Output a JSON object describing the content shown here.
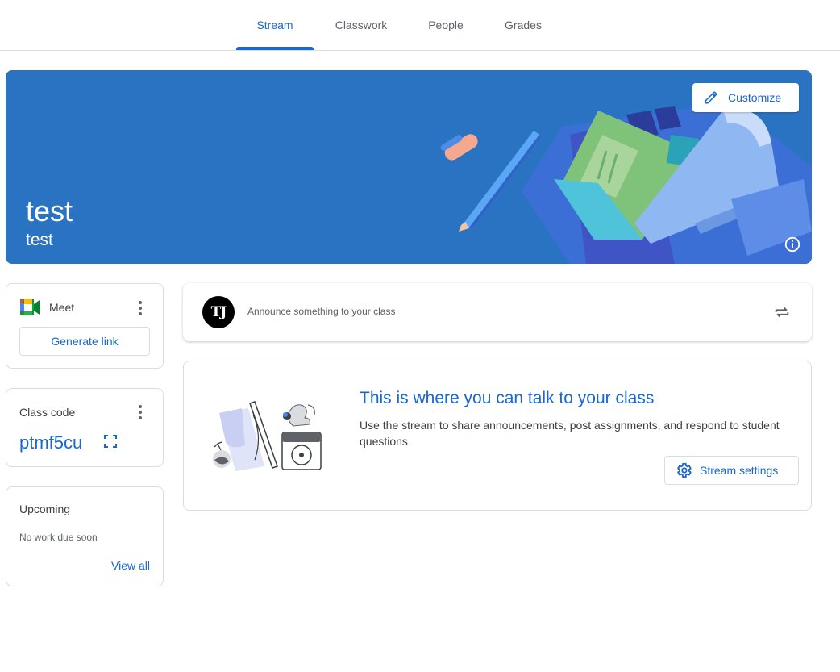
{
  "nav": {
    "tabs": [
      {
        "label": "Stream",
        "active": true
      },
      {
        "label": "Classwork",
        "active": false
      },
      {
        "label": "People",
        "active": false
      },
      {
        "label": "Grades",
        "active": false
      }
    ]
  },
  "banner": {
    "class_name": "test",
    "section": "test",
    "customize_label": "Customize",
    "background_color": "#2a73c3",
    "info_icon": "info-icon"
  },
  "meet": {
    "label": "Meet",
    "button_label": "Generate link",
    "icon": "google-meet-icon"
  },
  "class_code": {
    "title": "Class code",
    "value": "ptmf5cu",
    "icon": "fullscreen-icon"
  },
  "upcoming": {
    "title": "Upcoming",
    "empty_text": "No work due soon",
    "link_label": "View all"
  },
  "announce": {
    "avatar_initials": "TJ",
    "placeholder": "Announce something to your class",
    "icon": "repost-icon"
  },
  "talk": {
    "heading": "This is where you can talk to your class",
    "description": "Use the stream to share announcements, post assignments, and respond to student questions",
    "button_label": "Stream settings",
    "button_icon": "gear-icon"
  },
  "colors": {
    "accent": "#1967d2",
    "text": "#3c4043",
    "muted": "#5f6368",
    "border": "#dadce0"
  }
}
